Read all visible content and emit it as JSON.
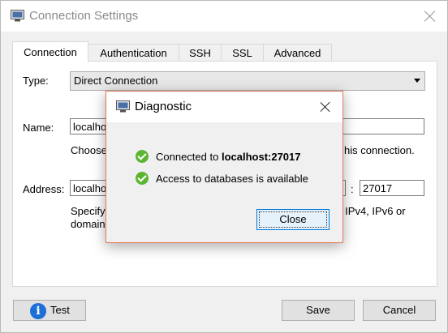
{
  "window": {
    "title": "Connection Settings"
  },
  "tabs": [
    {
      "label": "Connection",
      "active": true
    },
    {
      "label": "Authentication"
    },
    {
      "label": "SSH"
    },
    {
      "label": "SSL"
    },
    {
      "label": "Advanced"
    }
  ],
  "form": {
    "type_label": "Type:",
    "type_value": "Direct Connection",
    "name_label": "Name:",
    "name_value": "localhost",
    "name_hint": "Choose",
    "name_hint_tail": "his connection.",
    "address_label": "Address:",
    "address_host": "localhost",
    "address_sep": ":",
    "address_port": "27017",
    "address_hint_1": "Specify",
    "address_hint_1_tail": "er IPv4, IPv6 or",
    "address_hint_2": "domain"
  },
  "footer": {
    "test_label": "Test",
    "save_label": "Save",
    "cancel_label": "Cancel"
  },
  "dialog": {
    "title": "Diagnostic",
    "line1_prefix": "Connected to ",
    "line1_bold": "localhost:27017",
    "line2": "Access to databases is available",
    "close_label": "Close"
  },
  "colors": {
    "accent": "#0078d7",
    "success": "#5cb531",
    "info": "#1c6fd6",
    "dialog_border": "#e57b54"
  },
  "icons": [
    "app-monitor-icon",
    "close-icon",
    "chevron-down-icon",
    "info-icon",
    "check-icon"
  ]
}
